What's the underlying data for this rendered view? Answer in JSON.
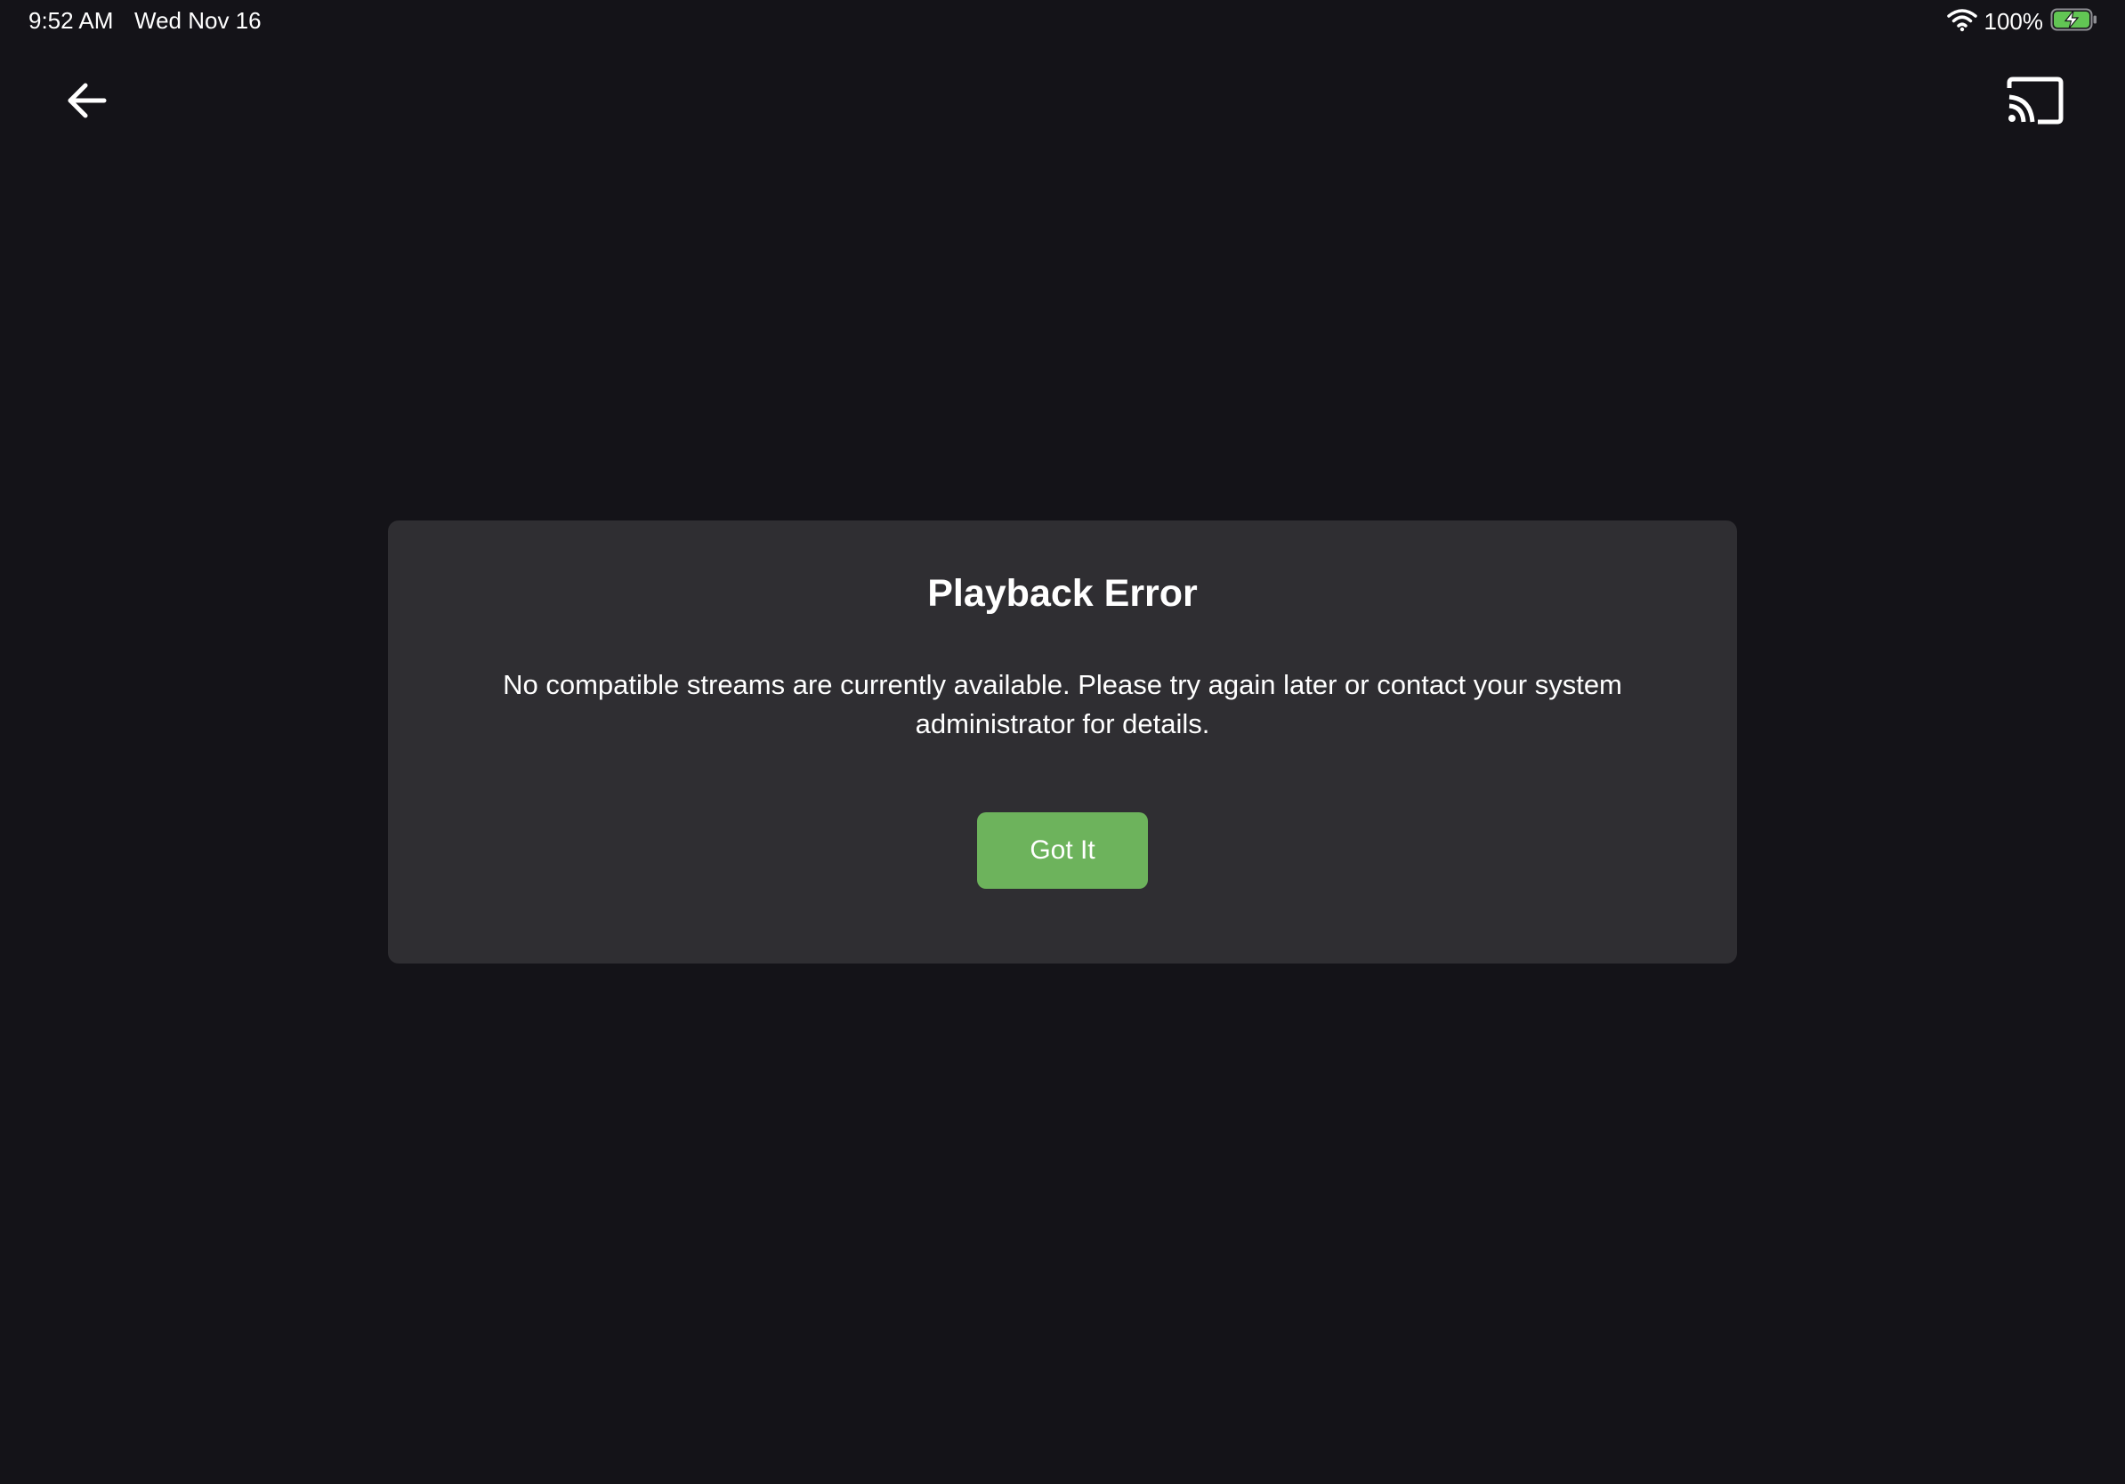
{
  "status_bar": {
    "time": "9:52 AM",
    "date": "Wed Nov 16",
    "battery_percent": "100%",
    "wifi_icon": "wifi-icon",
    "battery_icon": "battery-charging-icon"
  },
  "toolbar": {
    "back_icon": "arrow-left-icon",
    "cast_icon": "cast-icon"
  },
  "dialog": {
    "title": "Playback Error",
    "message": "No compatible streams are currently available. Please try again later or contact your system administrator for details.",
    "button_label": "Got It"
  },
  "colors": {
    "background": "#141318",
    "dialog_background": "#2f2e32",
    "button_accent": "#6db35c",
    "battery_fill": "#62c554"
  }
}
